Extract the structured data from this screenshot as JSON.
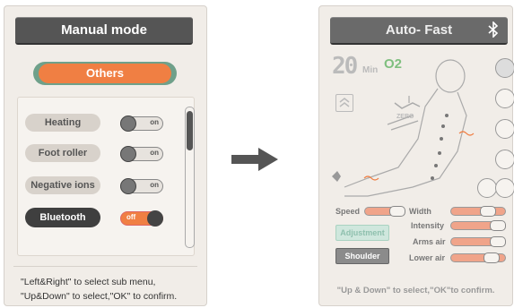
{
  "left": {
    "title": "Manual mode",
    "selector": "Others",
    "rows": [
      {
        "label": "Heating",
        "toggle": "on"
      },
      {
        "label": "Foot roller",
        "toggle": "on"
      },
      {
        "label": "Negative ions",
        "toggle": "on"
      },
      {
        "label": "Bluetooth",
        "toggle": "off"
      }
    ],
    "help_line1": "\"Left&Right\" to select sub menu,",
    "help_line2": "\"Up&Down\" to select,\"OK\" to confirm."
  },
  "right": {
    "title": "Auto- Fast",
    "timer": "20",
    "timer_unit": "Min",
    "o2": "O2",
    "zero": "ZERO",
    "speed_label": "Speed",
    "width_label": "Width",
    "intensity_label": "Intensity",
    "arms_air_label": "Arms air",
    "lower_air_label": "Lower air",
    "adjustment_label": "Adjustment",
    "shoulder_label": "Shoulder",
    "footer": "\"Up & Down\" to select,\"OK\"to confirm."
  },
  "icons": [
    "bluetooth-icon",
    "arrow-right-icon",
    "body-diagram-icon",
    "leaf-icon"
  ]
}
